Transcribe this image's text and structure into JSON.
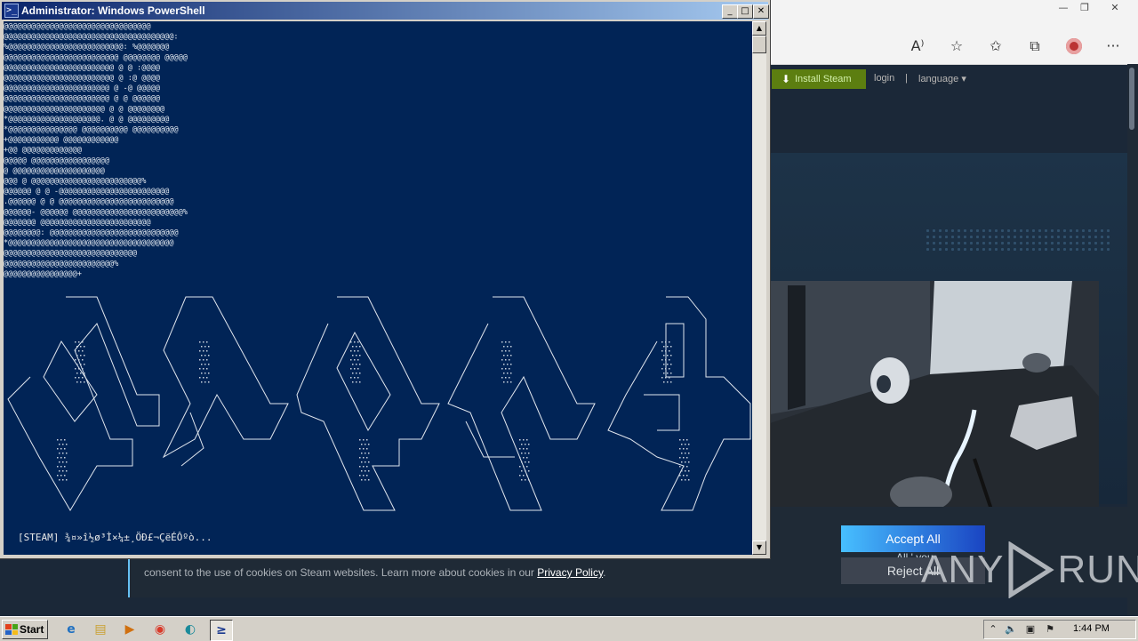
{
  "browser": {
    "window_controls": {
      "minimize": "—",
      "restore": "❐",
      "close": "✕"
    },
    "toolbar_icons": [
      "read-aloud-icon",
      "add-favorite-icon",
      "favorites-icon",
      "collections-icon",
      "profile-icon",
      "more-icon"
    ],
    "toolbar_glyphs": {
      "read_aloud": "A⁾",
      "add_favorite": "☆",
      "favorites": "✩",
      "collections": "⧉",
      "more": "···"
    }
  },
  "steam": {
    "install_button": "Install Steam",
    "login": "login",
    "separator": "|",
    "language": "language ▾",
    "cookie": {
      "fragment": "All,' you",
      "text_before_link": "consent to the use of cookies on Steam websites. Learn more about cookies in our ",
      "privacy_link": "Privacy Policy",
      "text_after_link": ".",
      "accept_label": "Accept All",
      "reject_label": "Reject All"
    },
    "watermark": "ANY RUN"
  },
  "powershell": {
    "title": "Administrator: Windows PowerShell",
    "title_icon": ">_",
    "buttons": {
      "minimize": "_",
      "maximize": "□",
      "close": "✕"
    },
    "art": [
      "                                                   @@@@@@@@@@@@@@@@@@@@@@@@@@@@@@@@",
      "                                                 @@@@@@@@@@@@@@@@@@@@@@@@@@@@@@@@@@@@@:",
      "                                               %@@@@@@@@@@@@@@@@@@@@@@@@@:         %@@@@@@@",
      "                                              @@@@@@@@@@@@@@@@@@@@@@@@@     @@@@@@@@   @@@@@",
      "                                             @@@@@@@@@@@@@@@@@@@@@@@@     @        @  :@@@@",
      "                                            @@@@@@@@@@@@@@@@@@@@@@@@     @          :@   @@@@",
      "                                           @@@@@@@@@@@@@@@@@@@@@@@     @            -@   @@@@@",
      "                                          @@@@@@@@@@@@@@@@@@@@@@@     @              @   @@@@@@",
      "                                         @@@@@@@@@@@@@@@@@@@@@@     @              @   @@@@@@@@",
      "                                         *@@@@@@@@@@@@@@@@@@@@.     @            @    @@@@@@@@@",
      "                                           *@@@@@@@@@@@@@@@        @@@@@@@@@@    @@@@@@@@@@",
      "                                              +@@@@@@@@@@@                     @@@@@@@@@@@@",
      "                                                   +@@                        @@@@@@@@@@@@@",
      "                                                         @@@@@            @@@@@@@@@@@@@@@@@",
      "                                                              @       @@@@@@@@@@@@@@@@@@@@",
      "                                            @@@                @   @@@@@@@@@@@@@@@@@@@@@@@@%",
      "                                             @@@@@@    @       @   -@@@@@@@@@@@@@@@@@@@@@@@@",
      "                                             .@@@@@@    @      @    @@@@@@@@@@@@@@@@@@@@@@@@@",
      "                                              @@@@@@-    @@@@@@    @@@@@@@@@@@@@@@@@@@@@@@@%",
      "                                               @@@@@@@            @@@@@@@@@@@@@@@@@@@@@@@@",
      "                                                @@@@@@@@:    @@@@@@@@@@@@@@@@@@@@@@@@@@@@",
      "                                                 *@@@@@@@@@@@@@@@@@@@@@@@@@@@@@@@@@@@@",
      "                                                    @@@@@@@@@@@@@@@@@@@@@@@@@@@@@",
      "                                                       @@@@@@@@@@@@@@@@@@@@@@@@%",
      "                                                           @@@@@@@@@@@@@@@@+"
    ],
    "status": "[STEAM] ¾¤»î½ø³Ì×¼±¸ÖÐ£¬ÇëÉÔºò..."
  },
  "taskbar": {
    "start": "Start",
    "apps": [
      {
        "name": "ie-icon",
        "glyph": "e"
      },
      {
        "name": "explorer-icon",
        "glyph": "▤"
      },
      {
        "name": "media-player-icon",
        "glyph": "▶"
      },
      {
        "name": "chrome-icon",
        "glyph": "◉"
      },
      {
        "name": "edge-icon",
        "glyph": "◐"
      },
      {
        "name": "powershell-icon",
        "glyph": "≥"
      }
    ],
    "tray_glyphs": {
      "chevron": "⌃",
      "volume": "🔈",
      "network": "▣",
      "flag": "⚑"
    },
    "clock": "1:44 PM"
  },
  "colors": {
    "ps_background": "#012456",
    "steam_green": "#5c7e10",
    "accept_start": "#47bfff",
    "accept_end": "#1a44c2",
    "taskbar": "#d4d0c8"
  }
}
